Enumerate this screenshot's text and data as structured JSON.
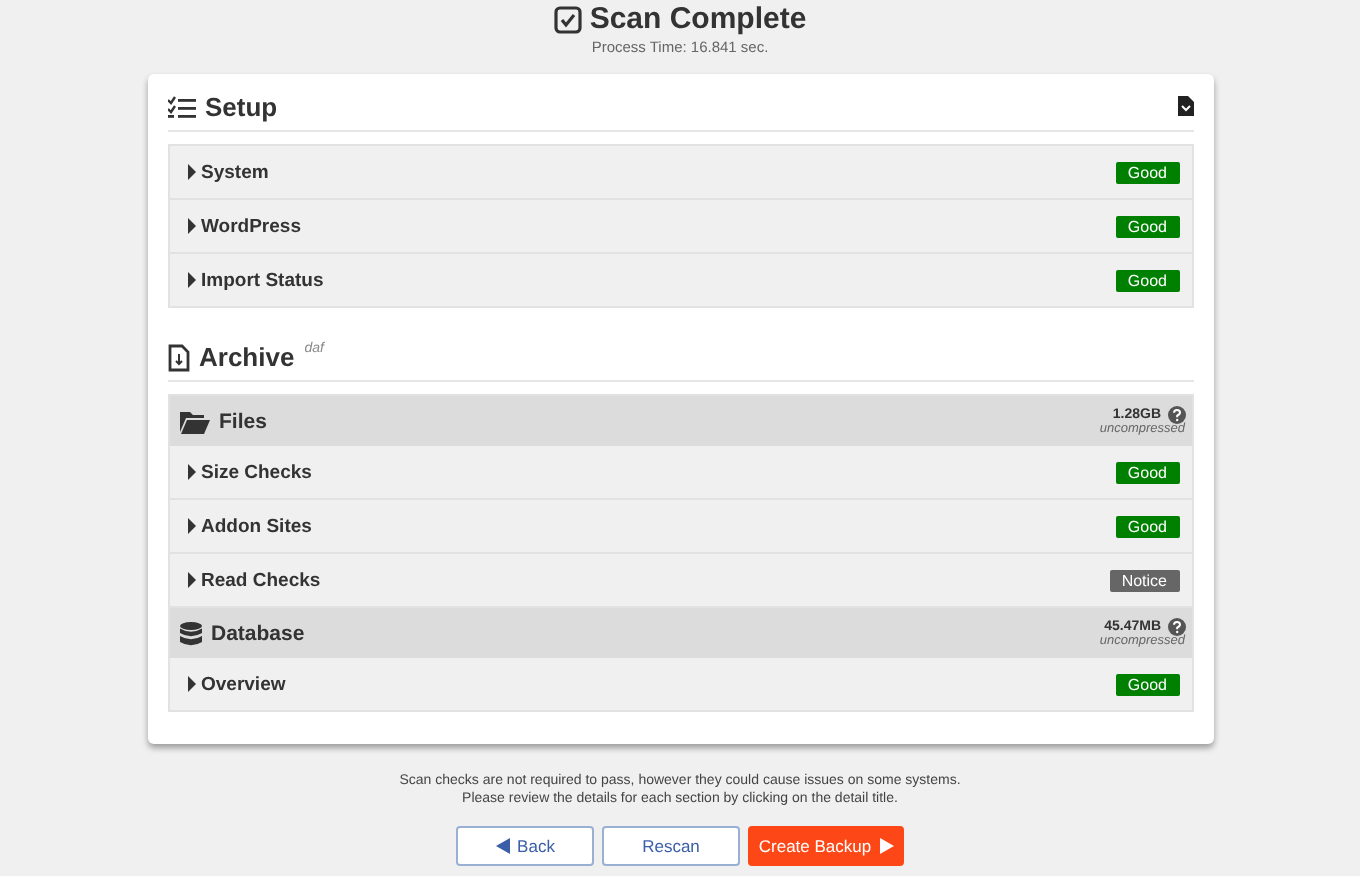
{
  "header": {
    "title": "Scan Complete",
    "subtitle": "Process Time: 16.841 sec."
  },
  "setup": {
    "title": "Setup",
    "rows": [
      {
        "label": "System",
        "status": "Good",
        "kind": "good"
      },
      {
        "label": "WordPress",
        "status": "Good",
        "kind": "good"
      },
      {
        "label": "Import Status",
        "status": "Good",
        "kind": "good"
      }
    ]
  },
  "archive": {
    "title": "Archive",
    "format": "daf",
    "groups": [
      {
        "title": "Files",
        "kind": "files",
        "size": "1.28GB",
        "note": "uncompressed",
        "rows": [
          {
            "label": "Size Checks",
            "status": "Good",
            "kind": "good"
          },
          {
            "label": "Addon Sites",
            "status": "Good",
            "kind": "good"
          },
          {
            "label": "Read Checks",
            "status": "Notice",
            "kind": "notice"
          }
        ]
      },
      {
        "title": "Database",
        "kind": "database",
        "size": "45.47MB",
        "note": "uncompressed",
        "rows": [
          {
            "label": "Overview",
            "status": "Good",
            "kind": "good"
          }
        ]
      }
    ]
  },
  "footer": {
    "notes": [
      "Scan checks are not required to pass, however they could cause issues on some systems.",
      "Please review the details for each section by clicking on the detail title."
    ]
  },
  "buttons": [
    {
      "label": "Back",
      "kind": "back"
    },
    {
      "label": "Rescan",
      "kind": "plain"
    },
    {
      "label": "Create Backup",
      "kind": "primary"
    }
  ]
}
